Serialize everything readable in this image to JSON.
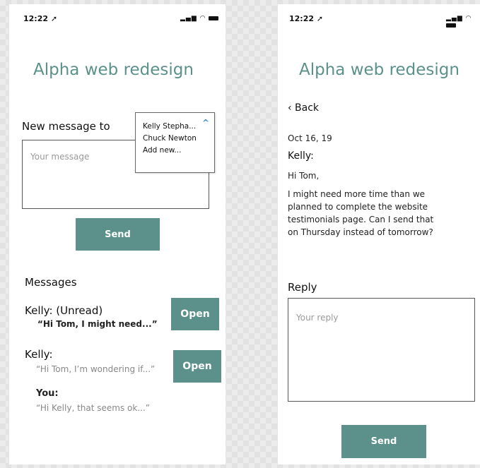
{
  "colors": {
    "accent": "#5b918a",
    "caret": "#3a8fd6",
    "backdrop": "#ececec"
  },
  "left_screen": {
    "status_time": "12:22",
    "status_signal_icons": "signal-wifi-battery",
    "title": "Alpha web redesign",
    "new_message_label": "New message to",
    "message_placeholder": "Your message",
    "recipient_dropdown": {
      "options": [
        "Kelly Stepha...",
        "Chuck Newton",
        "Add new..."
      ]
    },
    "send_label": "Send",
    "messages_heading": "Messages",
    "messages": [
      {
        "sender": "Kelly: (Unread)",
        "preview": "“Hi Tom, I might need...”",
        "open_label": "Open"
      },
      {
        "sender": "Kelly:",
        "preview": "“Hi Tom, I’m wondering if...”",
        "open_label": "Open"
      },
      {
        "sender": "You:",
        "preview": "“Hi Kelly, that seems ok...”"
      }
    ]
  },
  "right_screen": {
    "status_time": "12:22",
    "title": "Alpha web redesign",
    "back_label": "‹ Back",
    "date": "Oct 16, 19",
    "sender": "Kelly:",
    "greeting": "Hi Tom,",
    "body_lines": [
      "I might need more time than we",
      "planned to complete the website",
      "testimonials page. Can I send that",
      "on Thursday instead of tomorrow?"
    ],
    "reply_label": "Reply",
    "reply_placeholder": "Your reply",
    "send_label": "Send"
  }
}
